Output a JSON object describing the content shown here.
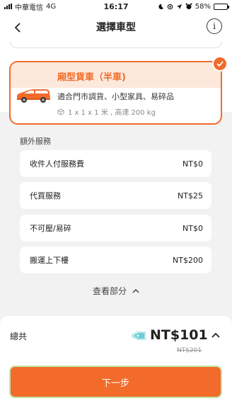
{
  "status_bar": {
    "carrier": "中華電信",
    "network": "4G",
    "time": "16:17",
    "battery_percent": "58%",
    "battery_level": 0.58
  },
  "header": {
    "title": "選擇車型",
    "info_glyph": "i"
  },
  "selected_vehicle": {
    "name": "廂型貨車（半車)",
    "description": "適合門市調貨、小型家具、易碎品",
    "spec": "1 x 1 x 1 米 , 高達 200 kg",
    "icon": "van-icon",
    "selected": true
  },
  "extra_services": {
    "title": "額外服務",
    "items": [
      {
        "label": "收件人付服務費",
        "price": "NT$0"
      },
      {
        "label": "代買服務",
        "price": "NT$25"
      },
      {
        "label": "不可壓/易碎",
        "price": "NT$0"
      },
      {
        "label": "搬運上下樓",
        "price": "NT$200"
      }
    ],
    "toggle_label": "查看部分"
  },
  "summary": {
    "total_label": "總共",
    "total_price": "NT$101",
    "original_price": "NT$201",
    "next_button": "下一步"
  },
  "colors": {
    "accent": "#f26b2a",
    "accent_light": "#fde9dc",
    "background": "#f2f2f2"
  }
}
